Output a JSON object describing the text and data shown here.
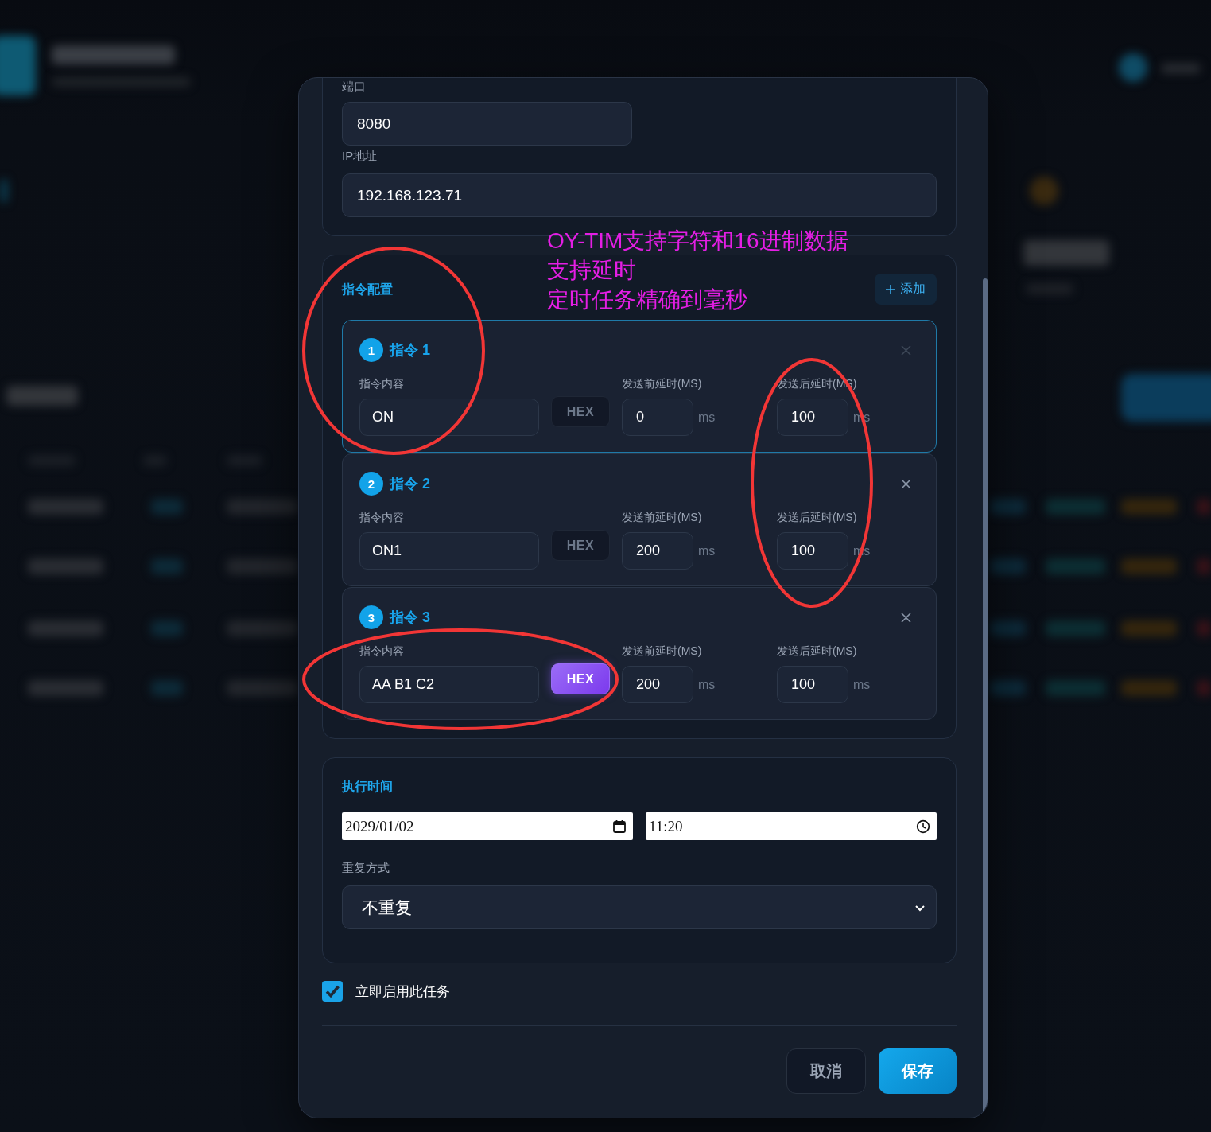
{
  "connection": {
    "fields": [
      {
        "kind": "port",
        "label": "端口",
        "value": "8080"
      },
      {
        "kind": "ip",
        "label": "IP地址",
        "value": "192.168.123.71"
      }
    ]
  },
  "commands": {
    "title": "指令配置",
    "add_label": "添加",
    "items": [
      {
        "number": "1",
        "title": "指令 1",
        "selected": true,
        "remove_disabled": true,
        "content_label": "指令内容",
        "content": "ON",
        "hex_label": "HEX",
        "hex": false,
        "before_label": "发送前延时(MS)",
        "before": "0",
        "before_unit": "ms",
        "after_label": "发送后延时(MS)",
        "after": "100",
        "after_unit": "ms"
      },
      {
        "number": "2",
        "title": "指令 2",
        "selected": false,
        "remove_disabled": false,
        "content_label": "指令内容",
        "content": "ON1",
        "hex_label": "HEX",
        "hex": false,
        "before_label": "发送前延时(MS)",
        "before": "200",
        "before_unit": "ms",
        "after_label": "发送后延时(MS)",
        "after": "100",
        "after_unit": "ms"
      },
      {
        "number": "3",
        "title": "指令 3",
        "selected": false,
        "remove_disabled": false,
        "content_label": "指令内容",
        "content": "AA B1 C2",
        "hex_label": "HEX",
        "hex": true,
        "before_label": "发送前延时(MS)",
        "before": "200",
        "before_unit": "ms",
        "after_label": "发送后延时(MS)",
        "after": "100",
        "after_unit": "ms"
      }
    ]
  },
  "schedule": {
    "title": "执行时间",
    "date": "2029/01/02",
    "time": "11:20",
    "repeat_label": "重复方式",
    "repeat": "不重复"
  },
  "enable": {
    "label": "立即启用此任务",
    "checked": true
  },
  "buttons": [
    {
      "kind": "secondary",
      "label": "取消"
    },
    {
      "kind": "primary",
      "label": "保存"
    }
  ],
  "annotation": {
    "lines": [
      "OY-TIM支持字符和16进制数据",
      "支持延时",
      "定时任务精确到毫秒"
    ]
  }
}
